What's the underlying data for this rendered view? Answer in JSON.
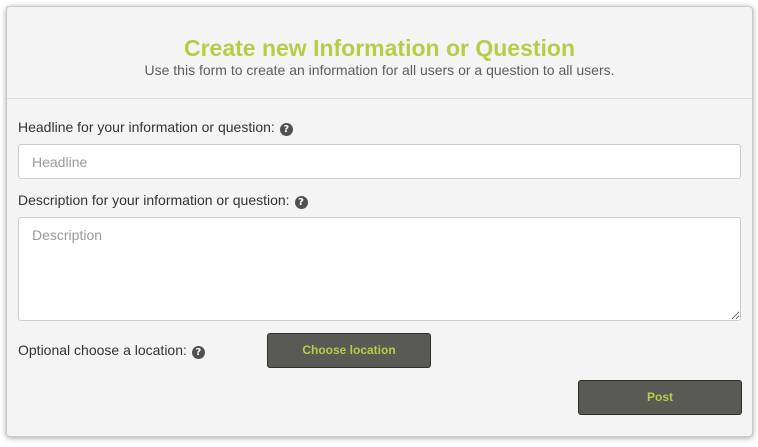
{
  "header": {
    "title": "Create new Information or Question",
    "subtitle": "Use this form to create an information for all users or a question to all users."
  },
  "form": {
    "headline": {
      "label": "Headline for your information or question:",
      "placeholder": "Headline",
      "value": "",
      "help_icon": "question-circle"
    },
    "description": {
      "label": "Description for your information or question:",
      "placeholder": "Description",
      "value": "",
      "help_icon": "question-circle"
    },
    "location": {
      "label": "Optional choose a location:",
      "help_icon": "question-circle",
      "button_label": "Choose location"
    },
    "post_label": "Post"
  },
  "colors": {
    "accent": "#b6cd47",
    "button_bg": "#5a5a55",
    "panel_bg": "#f4f4f4"
  }
}
